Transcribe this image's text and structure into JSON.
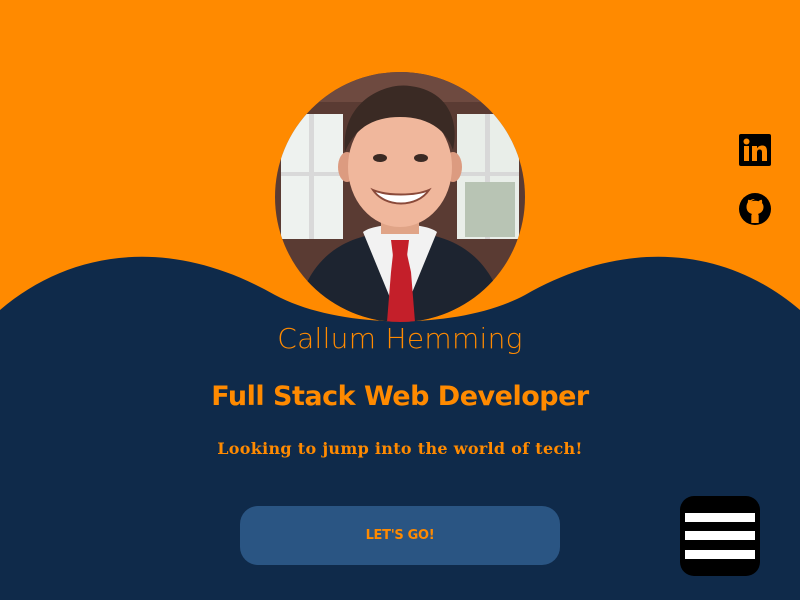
{
  "profile": {
    "name": "Callum Hemming",
    "title": "Full Stack Web Developer",
    "tagline": "Looking to jump into the world of tech!",
    "cta_label": "LET'S GO!"
  },
  "socials": [
    {
      "icon": "linkedin-icon",
      "label": "in"
    },
    {
      "icon": "github-icon"
    }
  ],
  "menu": {
    "icon": "hamburger-menu-icon"
  },
  "colors": {
    "accent": "#ff8a00",
    "navy": "#0f2a4a",
    "button": "#2a5583",
    "menu_bg": "#000000"
  }
}
